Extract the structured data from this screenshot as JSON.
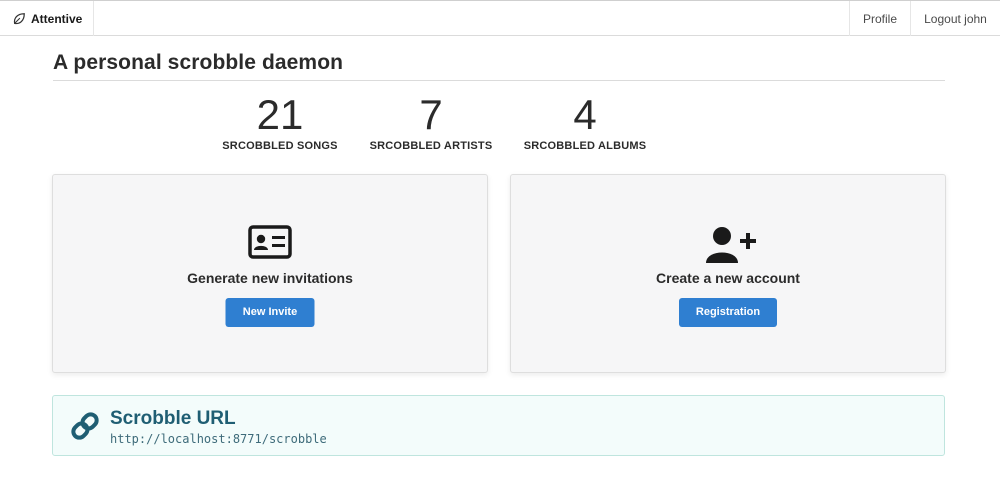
{
  "navbar": {
    "brand_icon": "leaf-icon",
    "brand_label": "Attentive",
    "profile_label": "Profile",
    "logout_label": "Logout john"
  },
  "page": {
    "title": "A personal scrobble daemon"
  },
  "stats": [
    {
      "value": "21",
      "label": "SRCOBBLED SONGS"
    },
    {
      "value": "7",
      "label": "SRCOBBLED ARTISTS"
    },
    {
      "value": "4",
      "label": "SRCOBBLED ALBUMS"
    }
  ],
  "cards": {
    "invite": {
      "icon": "id-card-icon",
      "title": "Generate new invitations",
      "button_label": "New Invite"
    },
    "account": {
      "icon": "user-plus-icon",
      "title": "Create a new account",
      "button_label": "Registration"
    }
  },
  "scrobble": {
    "icon": "link-icon",
    "title": "Scrobble URL",
    "url": "http://localhost:8771/scrobble"
  },
  "colors": {
    "primary_button": "#2f7fd1",
    "notice_background": "#f3fcfb",
    "notice_title": "#1f5e73"
  }
}
